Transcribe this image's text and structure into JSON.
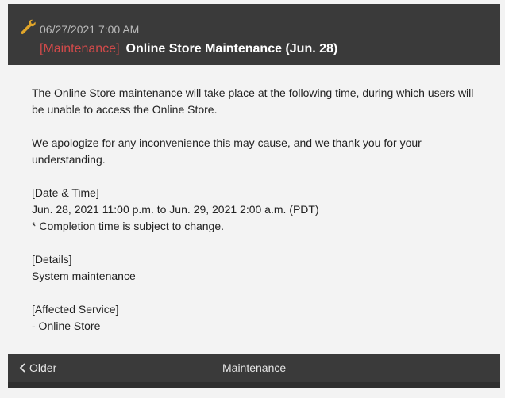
{
  "header": {
    "icon": "wrench-icon",
    "date": "06/27/2021 7:00 AM",
    "tag": "[Maintenance]",
    "title": "Online Store Maintenance (Jun. 28)"
  },
  "content": {
    "paragraphs": [
      {
        "lines": [
          "The Online Store maintenance will take place at the following time, during which users will be unable to access the Online Store."
        ]
      },
      {
        "lines": [
          "We apologize for any inconvenience this may cause, and we thank you for your understanding."
        ]
      },
      {
        "lines": [
          "[Date & Time]",
          "Jun. 28, 2021 11:00 p.m. to Jun. 29, 2021 2:00 a.m. (PDT)",
          "* Completion time is subject to change."
        ]
      },
      {
        "lines": [
          "[Details]",
          "System maintenance"
        ]
      },
      {
        "lines": [
          "[Affected Service]",
          "- Online Store"
        ]
      }
    ]
  },
  "footer": {
    "older_label": "Older",
    "category": "Maintenance"
  },
  "colors": {
    "tag": "#d24a4a",
    "header_bg": "#3a3a3a",
    "content_bg": "#f3f3f3",
    "wrench": "#e0a52a"
  }
}
